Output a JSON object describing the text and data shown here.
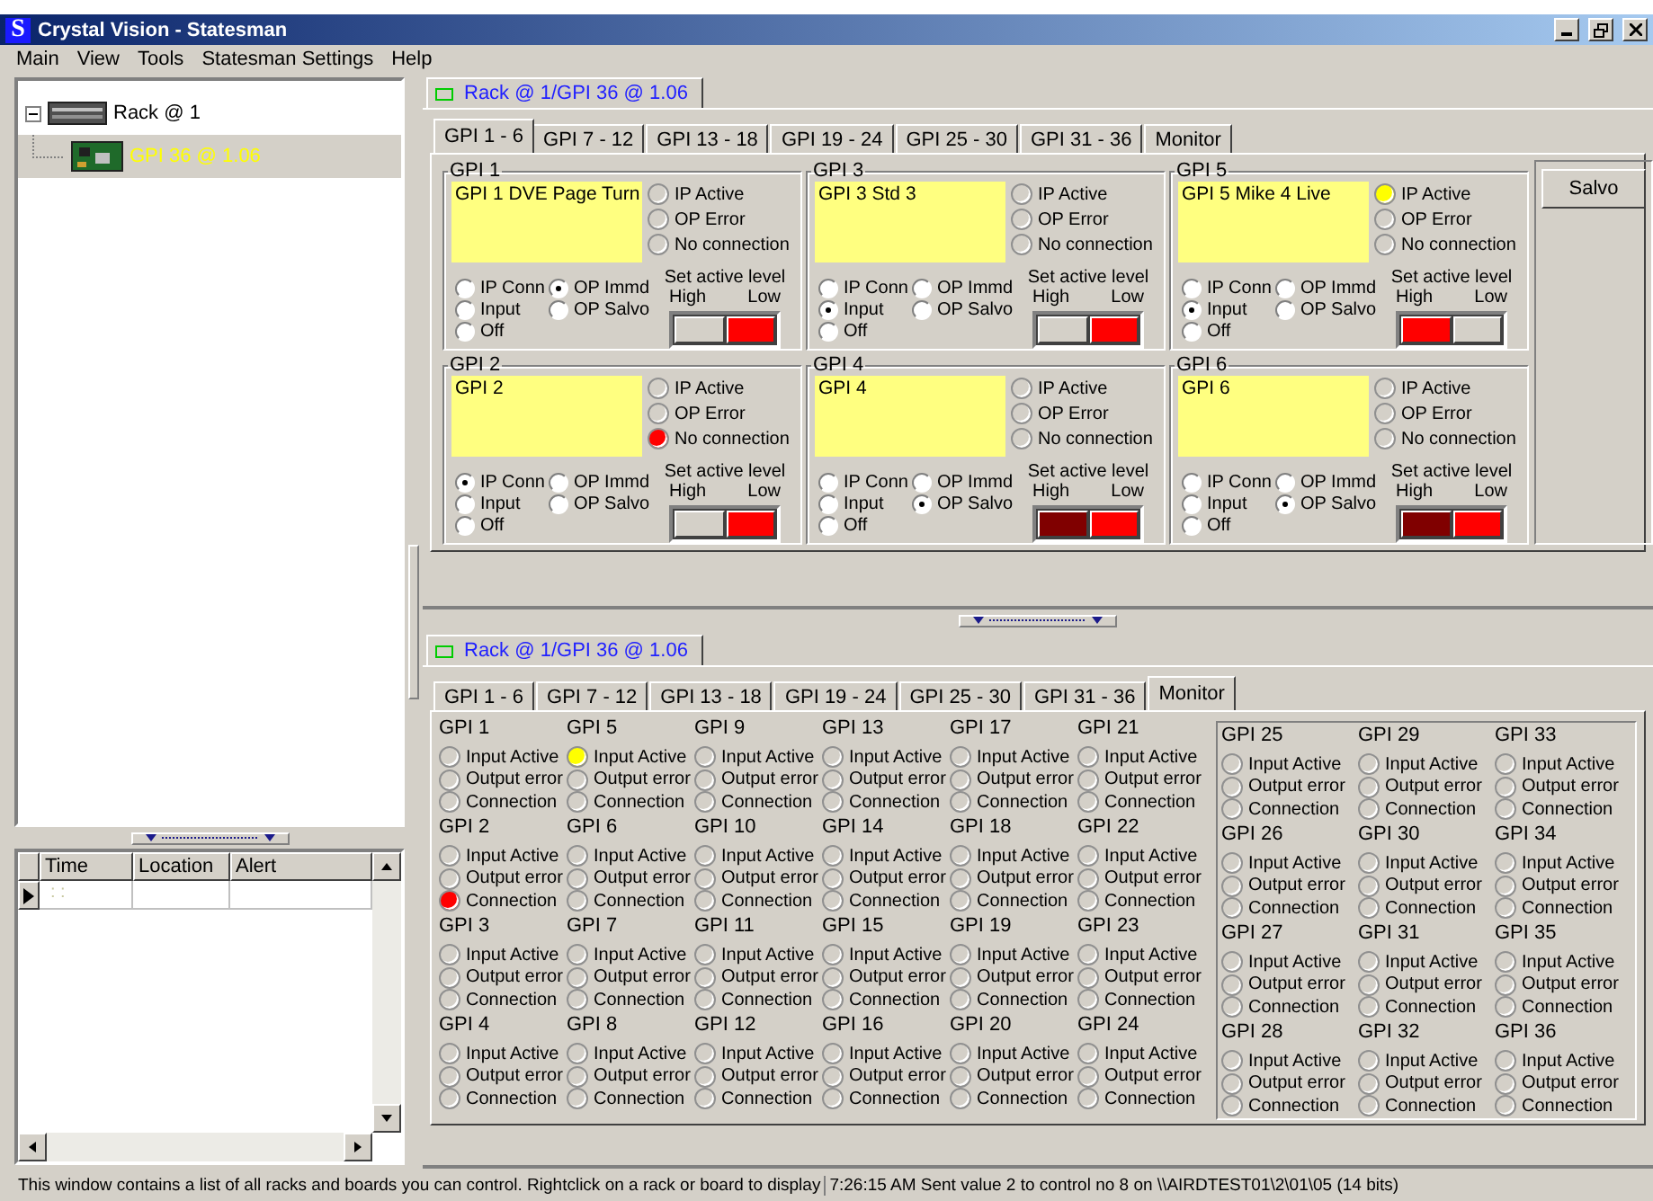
{
  "window": {
    "icon_letter": "S",
    "title": "Crystal Vision - Statesman"
  },
  "menu": [
    {
      "label": "Main"
    },
    {
      "label": "View"
    },
    {
      "label": "Tools"
    },
    {
      "label": "Statesman Settings"
    },
    {
      "label": "Help"
    }
  ],
  "tree": {
    "items": [
      {
        "label": "Rack @ 1",
        "expanded": true,
        "selected": false,
        "children": [
          {
            "label": "GPI 36 @ 1.06",
            "selected": true
          }
        ]
      }
    ]
  },
  "alert_table": {
    "columns": [
      "Time",
      "Location",
      "Alert"
    ],
    "rows": [
      {
        "time": ": :",
        "current": true
      }
    ]
  },
  "control_panel": {
    "document_tab": "Rack @ 1/GPI 36 @ 1.06",
    "tabs": [
      {
        "label": "GPI 1 - 6",
        "selected": true
      },
      {
        "label": "GPI 7 - 12",
        "selected": false
      },
      {
        "label": "GPI 13 - 18",
        "selected": false
      },
      {
        "label": "GPI 19 - 24",
        "selected": false
      },
      {
        "label": "GPI 25 - 30",
        "selected": false
      },
      {
        "label": "GPI 31 - 36",
        "selected": false
      },
      {
        "label": "Monitor",
        "selected": false
      }
    ],
    "gpis": [
      {
        "title": "GPI 1",
        "name": "GPI 1 DVE Page Turn",
        "indicators": [
          {
            "label": "IP Active",
            "lit": false
          },
          {
            "label": "OP Error",
            "lit": false
          },
          {
            "label": "No connection",
            "lit": false
          }
        ],
        "modes": [
          {
            "label": "IP Conn",
            "selected": false
          },
          {
            "label": "OP Immd",
            "selected": true
          },
          {
            "label": "Input",
            "selected": false
          },
          {
            "label": "OP Salvo",
            "selected": false
          },
          {
            "label": "Off",
            "selected": false
          }
        ],
        "level_title": "Set active level",
        "high_label": "High",
        "low_label": "Low",
        "high_on": false,
        "high_dim": false,
        "low_on": true,
        "low_dim": false
      },
      {
        "title": "GPI 3",
        "name": "GPI 3 Std 3",
        "indicators": [
          {
            "label": "IP Active",
            "lit": false
          },
          {
            "label": "OP Error",
            "lit": false
          },
          {
            "label": "No connection",
            "lit": false
          }
        ],
        "modes": [
          {
            "label": "IP Conn",
            "selected": false
          },
          {
            "label": "OP Immd",
            "selected": false
          },
          {
            "label": "Input",
            "selected": true
          },
          {
            "label": "OP Salvo",
            "selected": false
          },
          {
            "label": "Off",
            "selected": false
          }
        ],
        "level_title": "Set active level",
        "high_label": "High",
        "low_label": "Low",
        "high_on": false,
        "high_dim": false,
        "low_on": true,
        "low_dim": false
      },
      {
        "title": "GPI 5",
        "name": "GPI 5 Mike 4 Live",
        "indicators": [
          {
            "label": "IP Active",
            "lit": true,
            "color": "#ffff00"
          },
          {
            "label": "OP Error",
            "lit": false
          },
          {
            "label": "No connection",
            "lit": false
          }
        ],
        "modes": [
          {
            "label": "IP Conn",
            "selected": false
          },
          {
            "label": "OP Immd",
            "selected": false
          },
          {
            "label": "Input",
            "selected": true
          },
          {
            "label": "OP Salvo",
            "selected": false
          },
          {
            "label": "Off",
            "selected": false
          }
        ],
        "level_title": "Set active level",
        "high_label": "High",
        "low_label": "Low",
        "high_on": true,
        "high_dim": false,
        "low_on": false,
        "low_dim": false
      },
      {
        "title": "GPI 2",
        "name": "GPI 2",
        "indicators": [
          {
            "label": "IP Active",
            "lit": false
          },
          {
            "label": "OP Error",
            "lit": false
          },
          {
            "label": "No connection",
            "lit": true,
            "color": "#ff0000"
          }
        ],
        "modes": [
          {
            "label": "IP Conn",
            "selected": true
          },
          {
            "label": "OP Immd",
            "selected": false
          },
          {
            "label": "Input",
            "selected": false
          },
          {
            "label": "OP Salvo",
            "selected": false
          },
          {
            "label": "Off",
            "selected": false
          }
        ],
        "level_title": "Set active level",
        "high_label": "High",
        "low_label": "Low",
        "high_on": false,
        "high_dim": false,
        "low_on": true,
        "low_dim": false
      },
      {
        "title": "GPI 4",
        "name": "GPI 4",
        "indicators": [
          {
            "label": "IP Active",
            "lit": false
          },
          {
            "label": "OP Error",
            "lit": false
          },
          {
            "label": "No connection",
            "lit": false
          }
        ],
        "modes": [
          {
            "label": "IP Conn",
            "selected": false
          },
          {
            "label": "OP Immd",
            "selected": false
          },
          {
            "label": "Input",
            "selected": false
          },
          {
            "label": "OP Salvo",
            "selected": true
          },
          {
            "label": "Off",
            "selected": false
          }
        ],
        "level_title": "Set active level",
        "high_label": "High",
        "low_label": "Low",
        "high_on": true,
        "high_dim": true,
        "low_on": true,
        "low_dim": false
      },
      {
        "title": "GPI 6",
        "name": "GPI 6",
        "indicators": [
          {
            "label": "IP Active",
            "lit": false
          },
          {
            "label": "OP Error",
            "lit": false
          },
          {
            "label": "No connection",
            "lit": false
          }
        ],
        "modes": [
          {
            "label": "IP Conn",
            "selected": false
          },
          {
            "label": "OP Immd",
            "selected": false
          },
          {
            "label": "Input",
            "selected": false
          },
          {
            "label": "OP Salvo",
            "selected": true
          },
          {
            "label": "Off",
            "selected": false
          }
        ],
        "level_title": "Set active level",
        "high_label": "High",
        "low_label": "Low",
        "high_on": true,
        "high_dim": true,
        "low_on": true,
        "low_dim": false
      }
    ],
    "salvo_button": "Salvo"
  },
  "monitor_panel": {
    "document_tab": "Rack @ 1/GPI 36 @ 1.06",
    "tabs": [
      {
        "label": "GPI 1 - 6",
        "selected": false
      },
      {
        "label": "GPI 7 - 12",
        "selected": false
      },
      {
        "label": "GPI 13 - 18",
        "selected": false
      },
      {
        "label": "GPI 19 - 24",
        "selected": false
      },
      {
        "label": "GPI 25 - 30",
        "selected": false
      },
      {
        "label": "GPI 31 - 36",
        "selected": false
      },
      {
        "label": "Monitor",
        "selected": true
      }
    ],
    "gpis": [
      {
        "title": "GPI 1",
        "indicators": [
          {
            "label": "Input Active",
            "lit": false
          },
          {
            "label": "Output error",
            "lit": false
          },
          {
            "label": "Connection",
            "lit": false
          }
        ]
      },
      {
        "title": "GPI 2",
        "indicators": [
          {
            "label": "Input Active",
            "lit": false
          },
          {
            "label": "Output error",
            "lit": false
          },
          {
            "label": "Connection",
            "lit": true,
            "color": "#ff0000"
          }
        ]
      },
      {
        "title": "GPI 3",
        "indicators": [
          {
            "label": "Input Active",
            "lit": false
          },
          {
            "label": "Output error",
            "lit": false
          },
          {
            "label": "Connection",
            "lit": false
          }
        ]
      },
      {
        "title": "GPI 4",
        "indicators": [
          {
            "label": "Input Active",
            "lit": false
          },
          {
            "label": "Output error",
            "lit": false
          },
          {
            "label": "Connection",
            "lit": false
          }
        ]
      },
      {
        "title": "GPI 5",
        "indicators": [
          {
            "label": "Input Active",
            "lit": true,
            "color": "#ffff00"
          },
          {
            "label": "Output error",
            "lit": false
          },
          {
            "label": "Connection",
            "lit": false
          }
        ]
      },
      {
        "title": "GPI 6",
        "indicators": [
          {
            "label": "Input Active",
            "lit": false
          },
          {
            "label": "Output error",
            "lit": false
          },
          {
            "label": "Connection",
            "lit": false
          }
        ]
      },
      {
        "title": "GPI 7",
        "indicators": [
          {
            "label": "Input Active",
            "lit": false
          },
          {
            "label": "Output error",
            "lit": false
          },
          {
            "label": "Connection",
            "lit": false
          }
        ]
      },
      {
        "title": "GPI 8",
        "indicators": [
          {
            "label": "Input Active",
            "lit": false
          },
          {
            "label": "Output error",
            "lit": false
          },
          {
            "label": "Connection",
            "lit": false
          }
        ]
      },
      {
        "title": "GPI 9",
        "indicators": [
          {
            "label": "Input Active",
            "lit": false
          },
          {
            "label": "Output error",
            "lit": false
          },
          {
            "label": "Connection",
            "lit": false
          }
        ]
      },
      {
        "title": "GPI 10",
        "indicators": [
          {
            "label": "Input Active",
            "lit": false
          },
          {
            "label": "Output error",
            "lit": false
          },
          {
            "label": "Connection",
            "lit": false
          }
        ]
      },
      {
        "title": "GPI 11",
        "indicators": [
          {
            "label": "Input Active",
            "lit": false
          },
          {
            "label": "Output error",
            "lit": false
          },
          {
            "label": "Connection",
            "lit": false
          }
        ]
      },
      {
        "title": "GPI 12",
        "indicators": [
          {
            "label": "Input Active",
            "lit": false
          },
          {
            "label": "Output error",
            "lit": false
          },
          {
            "label": "Connection",
            "lit": false
          }
        ]
      },
      {
        "title": "GPI 13",
        "indicators": [
          {
            "label": "Input Active",
            "lit": false
          },
          {
            "label": "Output error",
            "lit": false
          },
          {
            "label": "Connection",
            "lit": false
          }
        ]
      },
      {
        "title": "GPI 14",
        "indicators": [
          {
            "label": "Input Active",
            "lit": false
          },
          {
            "label": "Output error",
            "lit": false
          },
          {
            "label": "Connection",
            "lit": false
          }
        ]
      },
      {
        "title": "GPI 15",
        "indicators": [
          {
            "label": "Input Active",
            "lit": false
          },
          {
            "label": "Output error",
            "lit": false
          },
          {
            "label": "Connection",
            "lit": false
          }
        ]
      },
      {
        "title": "GPI 16",
        "indicators": [
          {
            "label": "Input Active",
            "lit": false
          },
          {
            "label": "Output error",
            "lit": false
          },
          {
            "label": "Connection",
            "lit": false
          }
        ]
      },
      {
        "title": "GPI 17",
        "indicators": [
          {
            "label": "Input Active",
            "lit": false
          },
          {
            "label": "Output error",
            "lit": false
          },
          {
            "label": "Connection",
            "lit": false
          }
        ]
      },
      {
        "title": "GPI 18",
        "indicators": [
          {
            "label": "Input Active",
            "lit": false
          },
          {
            "label": "Output error",
            "lit": false
          },
          {
            "label": "Connection",
            "lit": false
          }
        ]
      },
      {
        "title": "GPI 19",
        "indicators": [
          {
            "label": "Input Active",
            "lit": false
          },
          {
            "label": "Output error",
            "lit": false
          },
          {
            "label": "Connection",
            "lit": false
          }
        ]
      },
      {
        "title": "GPI 20",
        "indicators": [
          {
            "label": "Input Active",
            "lit": false
          },
          {
            "label": "Output error",
            "lit": false
          },
          {
            "label": "Connection",
            "lit": false
          }
        ]
      },
      {
        "title": "GPI 21",
        "indicators": [
          {
            "label": "Input Active",
            "lit": false
          },
          {
            "label": "Output error",
            "lit": false
          },
          {
            "label": "Connection",
            "lit": false
          }
        ]
      },
      {
        "title": "GPI 22",
        "indicators": [
          {
            "label": "Input Active",
            "lit": false
          },
          {
            "label": "Output error",
            "lit": false
          },
          {
            "label": "Connection",
            "lit": false
          }
        ]
      },
      {
        "title": "GPI 23",
        "indicators": [
          {
            "label": "Input Active",
            "lit": false
          },
          {
            "label": "Output error",
            "lit": false
          },
          {
            "label": "Connection",
            "lit": false
          }
        ]
      },
      {
        "title": "GPI 24",
        "indicators": [
          {
            "label": "Input Active",
            "lit": false
          },
          {
            "label": "Output error",
            "lit": false
          },
          {
            "label": "Connection",
            "lit": false
          }
        ]
      },
      {
        "title": "GPI 25",
        "indicators": [
          {
            "label": "Input Active",
            "lit": false
          },
          {
            "label": "Output error",
            "lit": false
          },
          {
            "label": "Connection",
            "lit": false
          }
        ]
      },
      {
        "title": "GPI 26",
        "indicators": [
          {
            "label": "Input Active",
            "lit": false
          },
          {
            "label": "Output error",
            "lit": false
          },
          {
            "label": "Connection",
            "lit": false
          }
        ]
      },
      {
        "title": "GPI 27",
        "indicators": [
          {
            "label": "Input Active",
            "lit": false
          },
          {
            "label": "Output error",
            "lit": false
          },
          {
            "label": "Connection",
            "lit": false
          }
        ]
      },
      {
        "title": "GPI 28",
        "indicators": [
          {
            "label": "Input Active",
            "lit": false
          },
          {
            "label": "Output error",
            "lit": false
          },
          {
            "label": "Connection",
            "lit": false
          }
        ]
      },
      {
        "title": "GPI 29",
        "indicators": [
          {
            "label": "Input Active",
            "lit": false
          },
          {
            "label": "Output error",
            "lit": false
          },
          {
            "label": "Connection",
            "lit": false
          }
        ]
      },
      {
        "title": "GPI 30",
        "indicators": [
          {
            "label": "Input Active",
            "lit": false
          },
          {
            "label": "Output error",
            "lit": false
          },
          {
            "label": "Connection",
            "lit": false
          }
        ]
      },
      {
        "title": "GPI 31",
        "indicators": [
          {
            "label": "Input Active",
            "lit": false
          },
          {
            "label": "Output error",
            "lit": false
          },
          {
            "label": "Connection",
            "lit": false
          }
        ]
      },
      {
        "title": "GPI 32",
        "indicators": [
          {
            "label": "Input Active",
            "lit": false
          },
          {
            "label": "Output error",
            "lit": false
          },
          {
            "label": "Connection",
            "lit": false
          }
        ]
      },
      {
        "title": "GPI 33",
        "indicators": [
          {
            "label": "Input Active",
            "lit": false
          },
          {
            "label": "Output error",
            "lit": false
          },
          {
            "label": "Connection",
            "lit": false
          }
        ]
      },
      {
        "title": "GPI 34",
        "indicators": [
          {
            "label": "Input Active",
            "lit": false
          },
          {
            "label": "Output error",
            "lit": false
          },
          {
            "label": "Connection",
            "lit": false
          }
        ]
      },
      {
        "title": "GPI 35",
        "indicators": [
          {
            "label": "Input Active",
            "lit": false
          },
          {
            "label": "Output error",
            "lit": false
          },
          {
            "label": "Connection",
            "lit": false
          }
        ]
      },
      {
        "title": "GPI 36",
        "indicators": [
          {
            "label": "Input Active",
            "lit": false
          },
          {
            "label": "Output error",
            "lit": false
          },
          {
            "label": "Connection",
            "lit": false
          }
        ]
      }
    ]
  },
  "status_bar": {
    "hint": "This window contains a list of all racks and boards you can control. Rightclick on a rack or board to display",
    "message": "7:26:15 AM Sent value 2 to control no 8 on \\\\AIRDTEST01\\2\\01\\05 (14 bits)"
  }
}
